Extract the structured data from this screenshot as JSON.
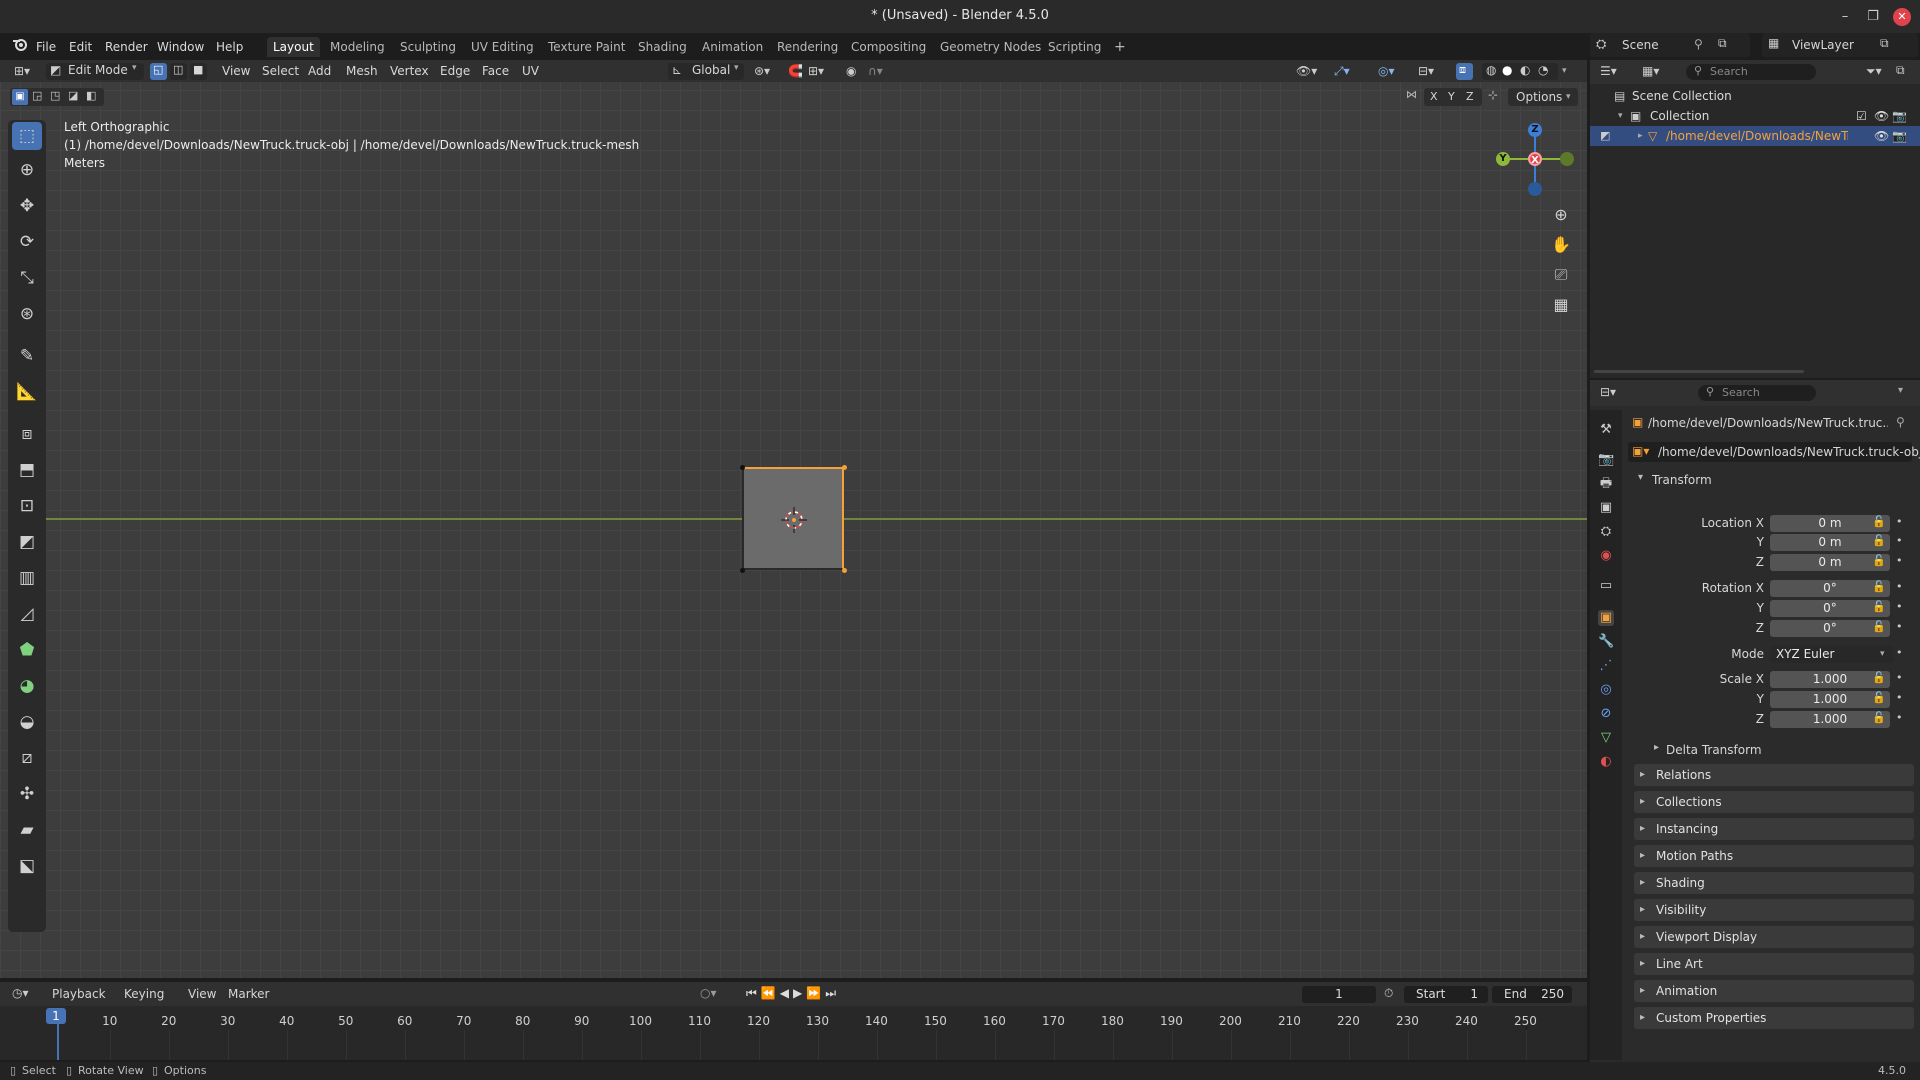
{
  "window": {
    "title": "* (Unsaved) - Blender 4.5.0",
    "minimize": "–",
    "maximize": "❐",
    "close": "✕"
  },
  "menu": {
    "items": [
      "File",
      "Edit",
      "Render",
      "Window",
      "Help"
    ]
  },
  "workspaces": {
    "tabs": [
      "Layout",
      "Modeling",
      "Sculpting",
      "UV Editing",
      "Texture Paint",
      "Shading",
      "Animation",
      "Rendering",
      "Compositing",
      "Geometry Nodes",
      "Scripting"
    ],
    "active": "Layout",
    "add": "+"
  },
  "scene": {
    "name": "Scene",
    "view_layer": "ViewLayer"
  },
  "viewport_header": {
    "mode": "Edit Mode",
    "menus": [
      "View",
      "Select",
      "Add",
      "Mesh",
      "Vertex",
      "Edge",
      "Face",
      "UV"
    ],
    "transform_orientation": "Global",
    "axis_x": "X",
    "axis_y": "Y",
    "axis_z": "Z",
    "options": "Options"
  },
  "viewport_overlay": {
    "view_name": "Left Orthographic",
    "object_path": "(1) /home/devel/Downloads/NewTruck.truck-obj | /home/devel/Downloads/NewTruck.truck-mesh",
    "units": "Meters"
  },
  "gizmo": {
    "z": "Z",
    "y": "Y",
    "x": "X"
  },
  "timeline": {
    "menus": [
      "Playback",
      "Keying",
      "View",
      "Marker"
    ],
    "current_frame": "1",
    "start_label": "Start",
    "start": "1",
    "end_label": "End",
    "end": "250",
    "ticks": [
      "10",
      "20",
      "30",
      "40",
      "50",
      "60",
      "70",
      "80",
      "90",
      "100",
      "110",
      "120",
      "130",
      "140",
      "150",
      "160",
      "170",
      "180",
      "190",
      "200",
      "210",
      "220",
      "230",
      "240",
      "250"
    ]
  },
  "status_bar": {
    "select": "Select",
    "rotate": "Rotate View",
    "options": "Options",
    "version": "4.5.0"
  },
  "outliner": {
    "search_placeholder": "Search",
    "scene_collection": "Scene Collection",
    "collection": "Collection",
    "object": "/home/devel/Downloads/NewTru"
  },
  "properties": {
    "search_placeholder": "Search",
    "object_title": "/home/devel/Downloads/NewTruck.truc...",
    "object_name": "/home/devel/Downloads/NewTruck.truck-obj",
    "transform_label": "Transform",
    "location_x_label": "Location X",
    "y_label": "Y",
    "z_label": "Z",
    "location_x": "0 m",
    "location_y": "0 m",
    "location_z": "0 m",
    "rotation_x_label": "Rotation X",
    "rotation_x": "0°",
    "rotation_y": "0°",
    "rotation_z": "0°",
    "mode_label": "Mode",
    "mode": "XYZ Euler",
    "scale_x_label": "Scale X",
    "scale_x": "1.000",
    "scale_y": "1.000",
    "scale_z": "1.000",
    "delta_transform": "Delta Transform",
    "panels": [
      "Relations",
      "Collections",
      "Instancing",
      "Motion Paths",
      "Shading",
      "Visibility",
      "Viewport Display",
      "Line Art",
      "Animation",
      "Custom Properties"
    ]
  },
  "colors": {
    "accent": "#4772b3",
    "selected_edge": "#f5a13a",
    "x_axis": "#e0434b",
    "y_axis": "#8fb83a",
    "z_axis": "#3d7fd6"
  }
}
